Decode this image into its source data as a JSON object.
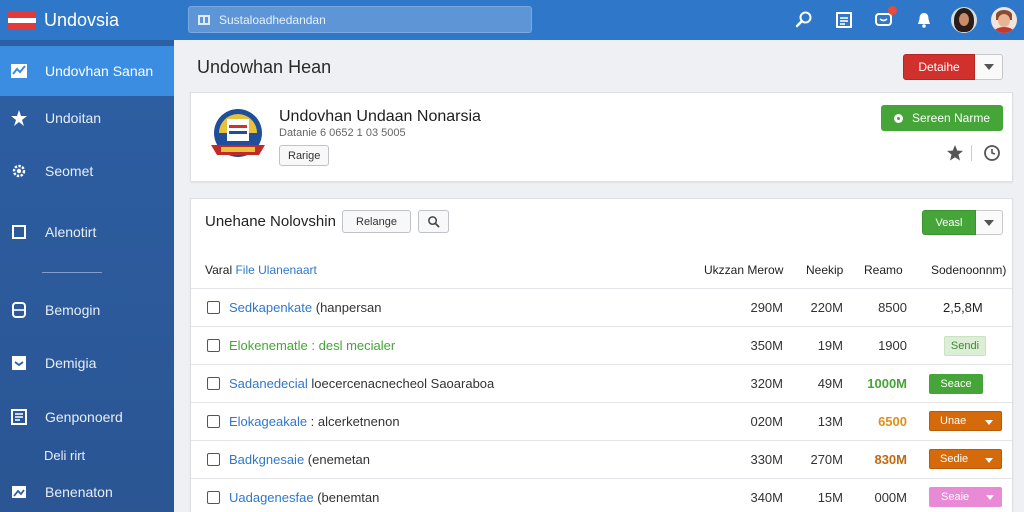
{
  "app": {
    "title": "Undovsia"
  },
  "search": {
    "placeholder": "Sustaloadhedandan"
  },
  "sidebar": {
    "items": [
      {
        "label": "Undovhan Sanan",
        "icon": "chart-icon",
        "active": true
      },
      {
        "label": "Undoitan",
        "icon": "star-burst-icon"
      },
      {
        "label": "Seomet",
        "icon": "gear-icon"
      },
      {
        "label": "Alenotirt",
        "icon": "square-icon"
      },
      {
        "label": "Bemogin",
        "icon": "database-icon"
      },
      {
        "label": "Demigia",
        "icon": "inbox-icon"
      },
      {
        "label": "Genponoerd",
        "icon": "document-icon"
      },
      {
        "label": "Deli rirt",
        "icon": ""
      },
      {
        "label": "Benenaton",
        "icon": "image-icon"
      }
    ]
  },
  "header": {
    "page_title": "Undowhan Hean",
    "details_label": "Detaihe"
  },
  "profile": {
    "name": "Undovhan Undaan Nonarsia",
    "subtitle": "Datanie 6 0652 1 03 5005",
    "tag": "Rarige",
    "action_label": "Sereen Narme"
  },
  "table": {
    "title": "Unehane Nolovshin",
    "relange_label": "Relange",
    "view_label": "Veasl",
    "header_first_prefix": "Varal",
    "header_first_accent": "File Ulanenaart",
    "columns": [
      "Ukzzan Merow",
      "Neekip",
      "Reamo",
      "Sodenoonnm)"
    ],
    "rows": [
      {
        "link": "Sedkapenkate",
        "rest": " (hanpersan",
        "c1": "290M",
        "c2": "220M",
        "c3": "8500",
        "c4": "2,5,8M",
        "tone": ""
      },
      {
        "link": "Elokenematle :",
        "rest": " desl mecialer",
        "c1": "350M",
        "c2": "19M",
        "c3": "1900",
        "pill": "Sendi",
        "tone": "green"
      },
      {
        "link": "Sadanedecial",
        "rest": " loecercenacnecheol Saoaraboa",
        "c1": "320M",
        "c2": "49M",
        "c3": "1000M",
        "pill": "Seace",
        "tone": ""
      },
      {
        "link": "Elokageakale",
        "rest": " : alcerketnenon",
        "c1": "020M",
        "c2": "13M",
        "c3": "6500",
        "pill": "Unae",
        "tone": ""
      },
      {
        "link": "Badkgnesaie",
        "rest": " (enemetan",
        "c1": "330M",
        "c2": "270M",
        "c3": "830M",
        "pill": "Sedie",
        "tone": ""
      },
      {
        "link": "Uadagenesfae",
        "rest": " (benemtan",
        "c1": "340M",
        "c2": "15M",
        "c3": "000M",
        "pill": "Seaie",
        "tone": ""
      }
    ]
  },
  "colors": {
    "topbar": "#2f78c9",
    "sidebar": "#2c5fa3",
    "sidebar_active": "#3a8de0",
    "danger": "#d0312d",
    "success": "#46a538",
    "warning": "#d56a0a",
    "pink": "#e88ad6"
  }
}
